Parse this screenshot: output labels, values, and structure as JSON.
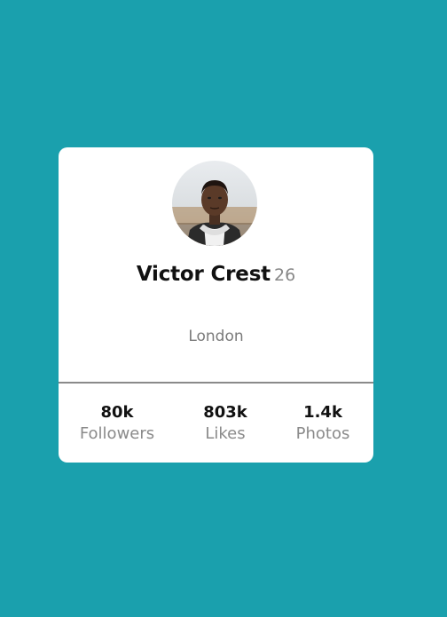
{
  "profile": {
    "name": "Victor Crest",
    "age": "26",
    "location": "London",
    "avatar_icon": "user-avatar-photo"
  },
  "stats": [
    {
      "value": "80k",
      "label": "Followers"
    },
    {
      "value": "803k",
      "label": "Likes"
    },
    {
      "value": "1.4k",
      "label": "Photos"
    }
  ],
  "colors": {
    "background": "#1aa0ad",
    "card": "#ffffff",
    "name": "#111111",
    "muted": "#8a8a8a"
  }
}
